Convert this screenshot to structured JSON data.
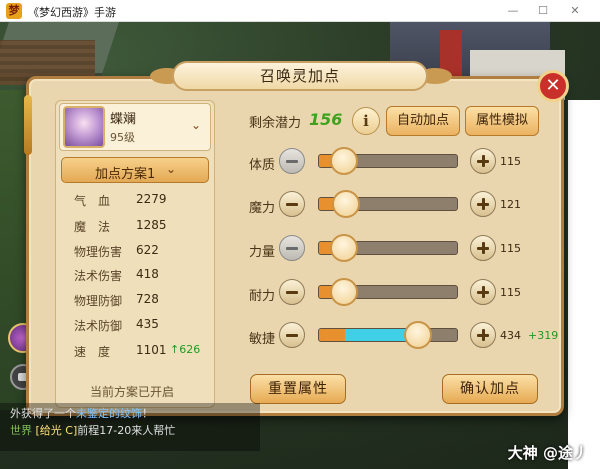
{
  "window": {
    "app_icon_text": "梦",
    "title": "《梦幻西游》手游",
    "controls": {
      "minimize": "—",
      "maximize": "☐",
      "close": "✕"
    }
  },
  "dialog": {
    "title": "召唤灵加点",
    "close_label": "✕"
  },
  "pet": {
    "name": "蝶斓",
    "level": "95级",
    "dropdown_icon": "chevron-down-icon"
  },
  "plan": {
    "label": "加点方案1",
    "status": "当前方案已开启"
  },
  "stats": [
    {
      "name": "气　血",
      "value": "2279",
      "increase": ""
    },
    {
      "name": "魔　法",
      "value": "1285",
      "increase": ""
    },
    {
      "name": "物理伤害",
      "value": "622",
      "increase": ""
    },
    {
      "name": "法术伤害",
      "value": "418",
      "increase": ""
    },
    {
      "name": "物理防御",
      "value": "728",
      "increase": ""
    },
    {
      "name": "法术防御",
      "value": "435",
      "increase": ""
    },
    {
      "name": "速　度",
      "value": "1101",
      "increase": "↑626"
    }
  ],
  "points": {
    "remaining_label": "剩余潜力",
    "remaining_value": "156",
    "info_label": "i",
    "auto_button": "自动加点",
    "simulate_button": "属性模拟"
  },
  "attributes": [
    {
      "label": "体质",
      "value": "115",
      "increase": "",
      "base_fraction": 0.19,
      "added_fraction": 0
    },
    {
      "label": "魔力",
      "value": "121",
      "increase": "",
      "base_fraction": 0.2,
      "added_fraction": 0
    },
    {
      "label": "力量",
      "value": "115",
      "increase": "",
      "base_fraction": 0.19,
      "added_fraction": 0
    },
    {
      "label": "耐力",
      "value": "115",
      "increase": "",
      "base_fraction": 0.19,
      "added_fraction": 0
    },
    {
      "label": "敏捷",
      "value": "434",
      "increase": "+319",
      "base_fraction": 0.19,
      "added_fraction": 0.52
    }
  ],
  "buttons": {
    "reset": "重置属性",
    "confirm": "确认加点"
  },
  "chat": {
    "line1_prefix": "外获得了一个",
    "line1_item": "未鉴定的纹饰",
    "line1_suffix": "！",
    "line2_tag": "世界",
    "line2_name": "[给光 C]",
    "line2_text": "前程17-20来人帮忙"
  },
  "watermark": "大神 @途丿",
  "colors": {
    "accent_green": "#3da31d",
    "dialog_bg": "#e9d6ae",
    "button_orange": "#eab261",
    "close_red": "#c9302a",
    "slider_added": "#3fd0e8",
    "slider_base": "#e8902e"
  }
}
